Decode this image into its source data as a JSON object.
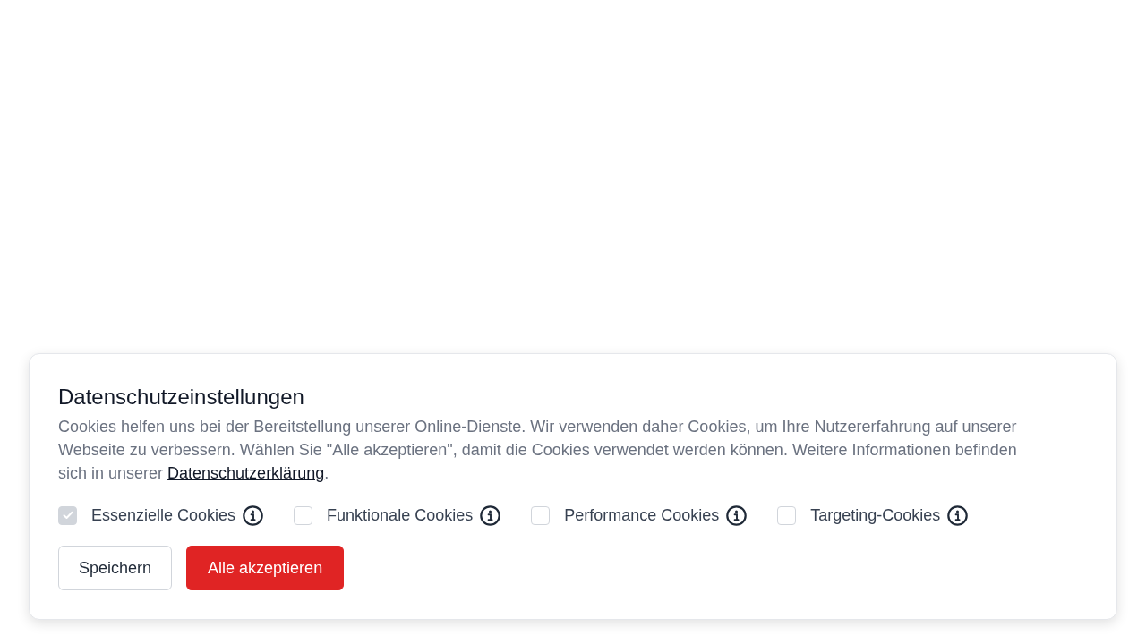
{
  "banner": {
    "title": "Datenschutzeinstellungen",
    "description": {
      "text": "Cookies helfen uns bei der Bereitstellung unserer Online-Dienste. Wir verwenden daher Cookies, um Ihre Nutzererfahrung auf unserer Webseite zu verbessern. Wählen Sie \"Alle akzeptieren\", damit die Cookies verwendet werden können. Weitere Informationen befinden sich in unserer ",
      "link": "Datenschutzerklärung",
      "suffix": "."
    },
    "options": [
      {
        "label": "Essenzielle Cookies",
        "checked": true,
        "disabled": true
      },
      {
        "label": "Funktionale Cookies",
        "checked": false,
        "disabled": false
      },
      {
        "label": "Performance Cookies",
        "checked": false,
        "disabled": false
      },
      {
        "label": "Targeting-Cookies",
        "checked": false,
        "disabled": false
      }
    ],
    "buttons": [
      {
        "label": "Speichern",
        "kind": "secondary"
      },
      {
        "label": "Alle akzeptieren",
        "kind": "primary"
      }
    ]
  }
}
